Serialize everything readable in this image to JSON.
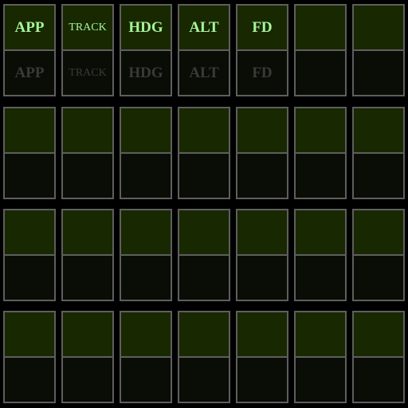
{
  "panel": {
    "columns": 7,
    "groups": 4,
    "colors": {
      "lit_background": "#182800",
      "dark_background": "#0a0c06",
      "border": "#5e5e5e",
      "lit_text": "#a6f49a",
      "dark_text": "#3a3a3a"
    },
    "buttons": [
      {
        "id": "app",
        "label": "APP"
      },
      {
        "id": "track",
        "label": "TRACK"
      },
      {
        "id": "hdg",
        "label": "HDG"
      },
      {
        "id": "alt",
        "label": "ALT"
      },
      {
        "id": "fd",
        "label": "FD"
      },
      {
        "id": "blank6",
        "label": ""
      },
      {
        "id": "blank7",
        "label": ""
      }
    ]
  }
}
